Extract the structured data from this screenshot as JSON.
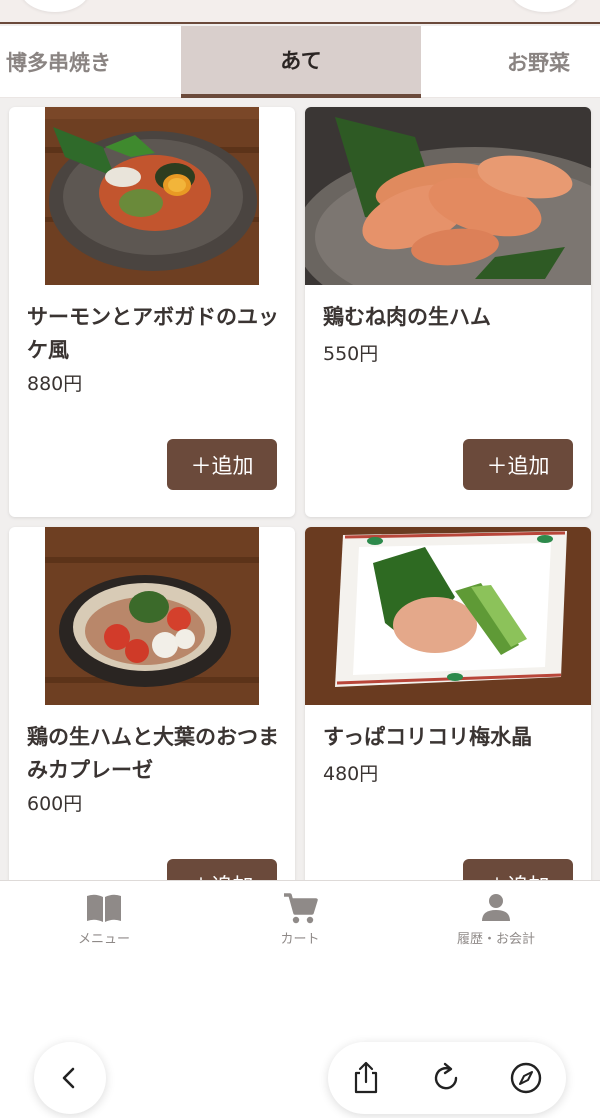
{
  "categories": {
    "items": [
      {
        "label": "博多串焼き"
      },
      {
        "label": "あて"
      },
      {
        "label": "お野菜"
      }
    ],
    "active_index": 1
  },
  "menu_items": [
    {
      "name": "サーモンとアボガドのユッケ風",
      "price": "880円",
      "add_label": "＋追加"
    },
    {
      "name": "鶏むね肉の生ハム",
      "price": "550円",
      "add_label": "＋追加"
    },
    {
      "name": "鶏の生ハムと大葉のおつまみカプレーゼ",
      "price": "600円",
      "add_label": "＋追加"
    },
    {
      "name": "すっぱコリコリ梅水晶",
      "price": "480円",
      "add_label": "＋追加"
    }
  ],
  "bottom_nav": {
    "items": [
      {
        "label": "メニュー",
        "icon": "book-icon"
      },
      {
        "label": "カート",
        "icon": "cart-icon"
      },
      {
        "label": "履歴・お会計",
        "icon": "person-icon"
      }
    ]
  },
  "browser_toolbar": {
    "icons": [
      "chevron-left-icon",
      "share-icon",
      "reload-icon",
      "compass-icon"
    ]
  },
  "colors": {
    "accent": "#6b4a3b",
    "active_tab_bg": "#d9cfcc",
    "text": "#3a3432",
    "muted": "#8f8a88"
  }
}
